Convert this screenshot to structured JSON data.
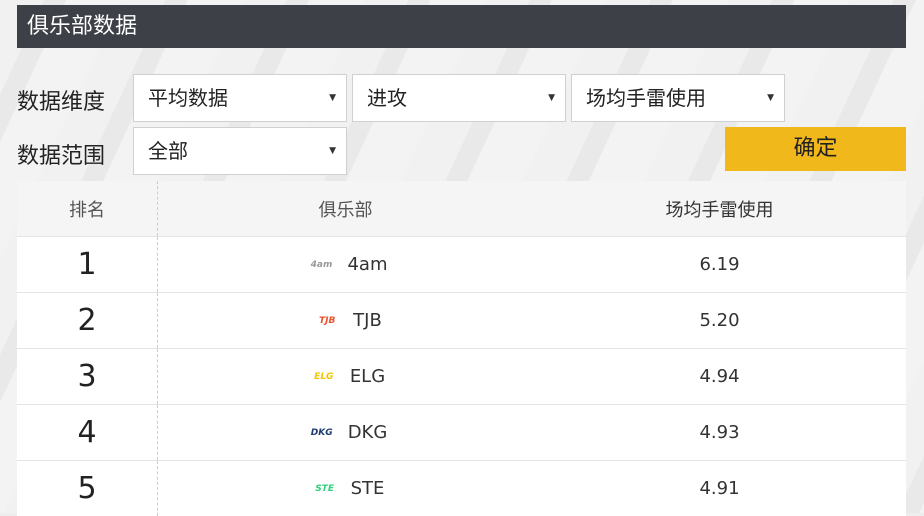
{
  "title": "俱乐部数据",
  "filters": {
    "dimension_label": "数据维度",
    "range_label": "数据范围",
    "select_type": "平均数据",
    "select_category": "进攻",
    "select_metric": "场均手雷使用",
    "select_range": "全部",
    "confirm": "确定"
  },
  "table": {
    "headers": [
      "排名",
      "俱乐部",
      "场均手雷使用"
    ],
    "rows": [
      {
        "rank": "1",
        "club": "4am",
        "value": "6.19",
        "logo_color": "#9a9a9a",
        "logo_text": "4am"
      },
      {
        "rank": "2",
        "club": "TJB",
        "value": "5.20",
        "logo_color": "#e8512a",
        "logo_text": "TJB"
      },
      {
        "rank": "3",
        "club": "ELG",
        "value": "4.94",
        "logo_color": "#f5c400",
        "logo_text": "ELG"
      },
      {
        "rank": "4",
        "club": "DKG",
        "value": "4.93",
        "logo_color": "#1d3c6e",
        "logo_text": "DKG"
      },
      {
        "rank": "5",
        "club": "STE",
        "value": "4.91",
        "logo_color": "#2fd17a",
        "logo_text": "STE"
      }
    ]
  }
}
